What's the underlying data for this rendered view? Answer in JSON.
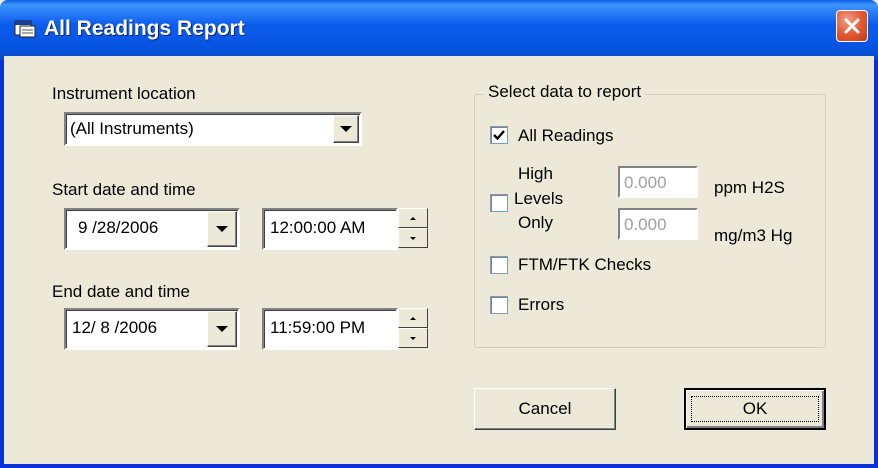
{
  "window": {
    "title": "All Readings Report",
    "icon": "report-window-icon",
    "close_icon": "close-icon"
  },
  "instrument": {
    "label": "Instrument location",
    "selected": "(All Instruments)"
  },
  "start": {
    "label": "Start date and time",
    "date": "9 /28/2006",
    "time": "12:00:00 AM"
  },
  "end": {
    "label": "End date and time",
    "date": "12/ 8 /2006",
    "time": "11:59:00 PM"
  },
  "select": {
    "legend": "Select data to report",
    "all_readings": {
      "label": "All Readings",
      "checked": true
    },
    "high_levels": {
      "label_line1": "High",
      "label_line2": "Levels",
      "label_line3": "Only",
      "checked": false,
      "h2s_value": "0.000",
      "h2s_unit": "ppm H2S",
      "hg_value": "0.000",
      "hg_unit": "mg/m3 Hg"
    },
    "ftm_checks": {
      "label": "FTM/FTK Checks",
      "checked": false
    },
    "errors": {
      "label": "Errors",
      "checked": false
    }
  },
  "buttons": {
    "cancel": "Cancel",
    "ok": "OK"
  },
  "colors": {
    "titlebar": "#0054e3",
    "face": "#ece9d8",
    "close": "#e35a35"
  }
}
